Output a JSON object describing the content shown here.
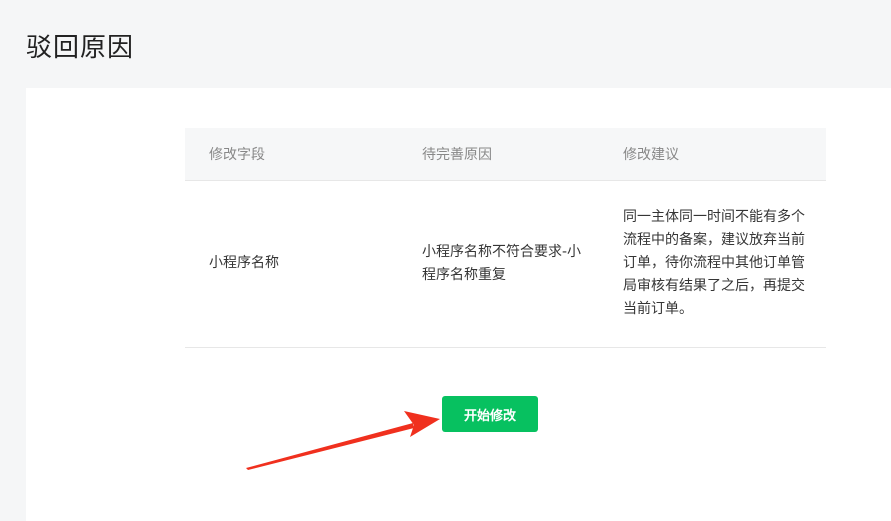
{
  "page": {
    "title": "驳回原因"
  },
  "table": {
    "headers": {
      "field": "修改字段",
      "reason": "待完善原因",
      "suggestion": "修改建议"
    },
    "rows": [
      {
        "field": "小程序名称",
        "reason": "小程序名称不符合要求-小程序名称重复",
        "suggestion": "同一主体同一时间不能有多个流程中的备案，建议放弃当前订单，待你流程中其他订单管局审核有结果了之后，再提交当前订单。"
      }
    ]
  },
  "actions": {
    "start_edit_label": "开始修改",
    "accent_color": "#07c160"
  },
  "annotation": {
    "arrow_color": "#f0301e",
    "arrow_icon": "red-pointer-arrow"
  }
}
